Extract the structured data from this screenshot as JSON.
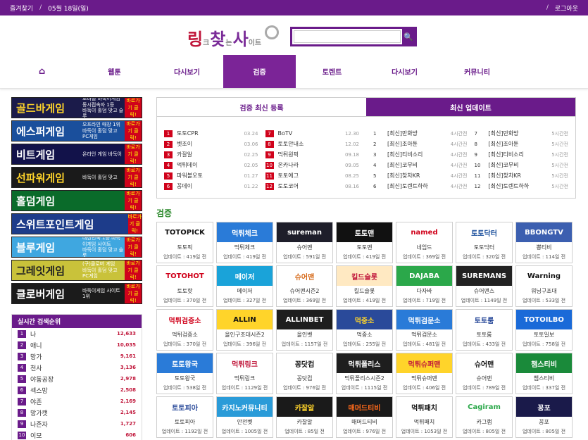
{
  "topbar": {
    "bookmark": "즐겨찾기",
    "date": "05월 18일(일)",
    "logout": "로그아웃"
  },
  "logo": {
    "p1": "링",
    "p2": "크",
    "p3": "찾",
    "p4": "는",
    "p5": "사",
    "p6": "이트"
  },
  "search": {
    "placeholder": "",
    "value": "",
    "icon": "search-icon"
  },
  "nav": [
    {
      "label": "",
      "icon": "home-icon"
    },
    {
      "label": "웹툰"
    },
    {
      "label": "다시보기"
    },
    {
      "label": "검증",
      "active": true
    },
    {
      "label": "토렌트"
    },
    {
      "label": "다시보기"
    },
    {
      "label": "커뮤니티"
    }
  ],
  "banners": [
    {
      "title": "골드바게임",
      "desc": "모바일 바둑이게임 동시접속자 1등",
      "sub": "바둑이 홀덤 맞고 슬롯",
      "cta": "바로가기 클릭!",
      "bg": "#1b1b4a",
      "fg": "#ffd42a"
    },
    {
      "title": "에스퍼게임",
      "desc": "오프라인 매장 1위",
      "sub": "바둑이 홀덤 맞고 PC게임",
      "cta": "바로가기 클릭!",
      "bg": "#1a4f9c",
      "fg": "#ffffff"
    },
    {
      "title": "비트게임",
      "desc": "온라인 게임 바둑이",
      "sub": "",
      "cta": "바로가기 클릭!",
      "bg": "#12124a",
      "fg": "#ffffff"
    },
    {
      "title": "선파워게임",
      "desc": "바둑이 홀덤 맞고",
      "sub": "",
      "cta": "바로가기 클릭!",
      "bg": "#1a1a1a",
      "fg": "#ffd42a"
    },
    {
      "title": "홀덤게임",
      "desc": "",
      "sub": "",
      "cta": "바로가기 클릭!",
      "bg": "#0a6b2a",
      "fg": "#ffffff"
    },
    {
      "title": "스위트포인트게임",
      "desc": "",
      "sub": "",
      "cta": "바로가기 클릭!",
      "bg": "#1d3c8a",
      "fg": "#ffffff"
    },
    {
      "title": "블루게임",
      "desc": "대한민국 1등 바둑이게임 사이트",
      "sub": "바둑이 홀덤 맞고 슬롯",
      "cta": "바로가기 클릭!",
      "bg": "#3fa7e0",
      "fg": "#ffffff"
    },
    {
      "title": "그레잇게임",
      "desc": "(구)클로버 게임",
      "sub": "바둑이 홀덤 맞고 PC게임",
      "cta": "바로가기 클릭!",
      "bg": "#c9c23a",
      "fg": "#222222"
    },
    {
      "title": "클로버게임",
      "desc": "바둑이게임 사이트 1위",
      "sub": "",
      "cta": "바로가기 클릭!",
      "bg": "#1b1b1b",
      "fg": "#ffffff"
    }
  ],
  "rank": {
    "title": "실시간 검색순위",
    "items": [
      {
        "n": "1",
        "t": "나",
        "c": "12,633"
      },
      {
        "n": "2",
        "t": "애니",
        "c": "10,035"
      },
      {
        "n": "3",
        "t": "망가",
        "c": "9,161"
      },
      {
        "n": "4",
        "t": "천사",
        "c": "3,136"
      },
      {
        "n": "5",
        "t": "야동공장",
        "c": "2,978"
      },
      {
        "n": "6",
        "t": "섹스망",
        "c": "2,508"
      },
      {
        "n": "7",
        "t": "야존",
        "c": "2,169"
      },
      {
        "n": "8",
        "t": "망가캣",
        "c": "2,145"
      },
      {
        "n": "9",
        "t": "나존자",
        "c": "1,727"
      },
      {
        "n": "10",
        "t": "이모",
        "c": "606"
      }
    ]
  },
  "recent": {
    "title": "검증 최신 등록",
    "col1": [
      {
        "n": "1",
        "t": "토토CPR",
        "d": "03.24"
      },
      {
        "n": "2",
        "t": "벳조이",
        "d": "03.06"
      },
      {
        "n": "3",
        "t": "카잘알",
        "d": "02.25"
      },
      {
        "n": "4",
        "t": "먹튀데이",
        "d": "02.05"
      },
      {
        "n": "5",
        "t": "파워볼오토",
        "d": "01.27"
      },
      {
        "n": "6",
        "t": "꽁데이",
        "d": "01.22"
      }
    ],
    "col2": [
      {
        "n": "7",
        "t": "BoTV",
        "d": "12.30"
      },
      {
        "n": "8",
        "t": "토토안내소",
        "d": "12.02"
      },
      {
        "n": "9",
        "t": "먹튀원픽",
        "d": "09.18"
      },
      {
        "n": "10",
        "t": "온카나라",
        "d": "09.05"
      },
      {
        "n": "11",
        "t": "토토에그",
        "d": "08.25"
      },
      {
        "n": "12",
        "t": "토토코어",
        "d": "08.16"
      }
    ]
  },
  "updates": {
    "title": "최신 업데이트",
    "col1": [
      {
        "n": "1",
        "t": "[최신]만화방",
        "d": "4시간전"
      },
      {
        "n": "2",
        "t": "[최신]조아툰",
        "d": "4시간전"
      },
      {
        "n": "3",
        "t": "[최신]티비소리",
        "d": "4시간전"
      },
      {
        "n": "4",
        "t": "[최신]코무비",
        "d": "4시간전"
      },
      {
        "n": "5",
        "t": "[최신]찾차KR",
        "d": "4시간전"
      },
      {
        "n": "6",
        "t": "[최신]토렌트하하",
        "d": "4시간전"
      }
    ],
    "col2": [
      {
        "n": "7",
        "t": "[최신]만화방",
        "d": "5시간전"
      },
      {
        "n": "8",
        "t": "[최신]조아툰",
        "d": "5시간전"
      },
      {
        "n": "9",
        "t": "[최신]티비소리",
        "d": "5시간전"
      },
      {
        "n": "10",
        "t": "[최신]코무비",
        "d": "5시간전"
      },
      {
        "n": "11",
        "t": "[최신]찾차KR",
        "d": "5시간전"
      },
      {
        "n": "12",
        "t": "[최신]토렌트하하",
        "d": "5시간전"
      }
    ]
  },
  "section_title": "검증",
  "cards": [
    {
      "logo": "TOTOPICK",
      "name": "토토픽",
      "up": "업데이트 : 419일 전",
      "bg": "#ffffff",
      "fg": "#111111"
    },
    {
      "logo": "먹튀체크",
      "name": "먹튀체크",
      "up": "업데이트 : 419일 전",
      "bg": "#2a7bd8",
      "fg": "#ffffff"
    },
    {
      "logo": "sureman",
      "name": "슈어맨",
      "up": "업데이트 : 591일 전",
      "bg": "#1e1e2a",
      "fg": "#ffffff"
    },
    {
      "logo": "토토맨",
      "name": "토토맨",
      "up": "업데이트 : 419일 전",
      "bg": "#111111",
      "fg": "#ffffff"
    },
    {
      "logo": "named",
      "name": "네임드",
      "up": "업데이트 : 369일 전",
      "bg": "#ffffff",
      "fg": "#d0021b"
    },
    {
      "logo": "토토닥터",
      "name": "토토닥터",
      "up": "업데이트 : 320일 전",
      "bg": "#ffffff",
      "fg": "#1a4f9c"
    },
    {
      "logo": "BBONGTV",
      "name": "뽕티비",
      "up": "업데이트 : 114일 전",
      "bg": "#3c5fb0",
      "fg": "#ffffff"
    },
    {
      "logo": "TOTOHOT",
      "name": "토토핫",
      "up": "업데이트 : 370일 전",
      "bg": "#ffffff",
      "fg": "#d0021b"
    },
    {
      "logo": "메이저",
      "name": "메이저",
      "up": "업데이트 : 327일 전",
      "bg": "#1aa3d9",
      "fg": "#ffffff"
    },
    {
      "logo": "슈어맨",
      "name": "슈어맨시즌2",
      "up": "업데이트 : 369일 전",
      "bg": "#ffffff",
      "fg": "#d66a1a"
    },
    {
      "logo": "킬드슬롯",
      "name": "킬드슬롯",
      "up": "업데이트 : 419일 전",
      "bg": "#ffe9c2",
      "fg": "#c0163a"
    },
    {
      "logo": "DAJABA",
      "name": "다자바",
      "up": "업데이트 : 719일 전",
      "bg": "#2ba84a",
      "fg": "#ffffff"
    },
    {
      "logo": "SUREMANS",
      "name": "슈어맨스",
      "up": "업데이트 : 1149일 전",
      "bg": "#222222",
      "fg": "#ffffff"
    },
    {
      "logo": "Warning",
      "name": "워닝구조대",
      "up": "업데이트 : 533일 전",
      "bg": "#ffffff",
      "fg": "#111111"
    },
    {
      "logo": "먹튀검증소",
      "name": "먹튀검증소",
      "up": "업데이트 : 370일 전",
      "bg": "#ffffff",
      "fg": "#d0021b"
    },
    {
      "logo": "ALLIN",
      "name": "올인구조대시즌2",
      "up": "업데이트 : 396일 전",
      "bg": "#ffd42a",
      "fg": "#111111"
    },
    {
      "logo": "ALLINBET",
      "name": "올인벳",
      "up": "업데이트 : 1157일 전",
      "bg": "#1e1e1e",
      "fg": "#ffffff"
    },
    {
      "logo": "먹중소",
      "name": "먹중소",
      "up": "업데이트 : 255일 전",
      "bg": "#2a4a9a",
      "fg": "#ffd42a"
    },
    {
      "logo": "먹튀검문소",
      "name": "먹튀검문소",
      "up": "업데이트 : 481일 전",
      "bg": "#2a7bd8",
      "fg": "#ffffff"
    },
    {
      "logo": "토토룸",
      "name": "토토룸",
      "up": "업데이트 : 433일 전",
      "bg": "#ffffff",
      "fg": "#2a4a9a"
    },
    {
      "logo": "TOTOILBO",
      "name": "토토일보",
      "up": "업데이트 : 758일 전",
      "bg": "#1a6ad8",
      "fg": "#ffffff"
    },
    {
      "logo": "토토왕국",
      "name": "토토왕국",
      "up": "업데이트 : 538일 전",
      "bg": "#2a7bd8",
      "fg": "#ffffff"
    },
    {
      "logo": "먹튀링크",
      "name": "먹튀링크",
      "up": "업데이트 : 1129일 전",
      "bg": "#ffffff",
      "fg": "#c0163a"
    },
    {
      "logo": "꽁닷컴",
      "name": "꽁닷컴",
      "up": "업데이트 : 976일 전",
      "bg": "#ffffff",
      "fg": "#111111"
    },
    {
      "logo": "먹튀폴리스",
      "name": "먹튀폴리스시즌2",
      "up": "업데이트 : 1115일 전",
      "bg": "#1e1e1e",
      "fg": "#ffffff"
    },
    {
      "logo": "먹튀슈퍼맨",
      "name": "먹튀슈퍼맨",
      "up": "업데이트 : 406일 전",
      "bg": "#ffd42a",
      "fg": "#c0163a"
    },
    {
      "logo": "슈어맨",
      "name": "슈어맨",
      "up": "업데이트 : 789일 전",
      "bg": "#ffffff",
      "fg": "#111111"
    },
    {
      "logo": "챔스티비",
      "name": "챔스티비",
      "up": "업데이트 : 337일 전",
      "bg": "#1a8a3a",
      "fg": "#ffffff"
    },
    {
      "logo": "토토피아",
      "name": "토토피아",
      "up": "업데이트 : 1192일 전",
      "bg": "#ffffff",
      "fg": "#2a4a9a"
    },
    {
      "logo": "카지노커뮤니티",
      "name": "안전벳",
      "up": "업데이트 : 1005일 전",
      "bg": "#2a9bd8",
      "fg": "#ffffff"
    },
    {
      "logo": "카잘알",
      "name": "카잘알",
      "up": "업데이트 : 85일 전",
      "bg": "#1a1a1a",
      "fg": "#ffd42a"
    },
    {
      "logo": "매머드티비",
      "name": "매머드티비",
      "up": "업데이트 : 976일 전",
      "bg": "#1a1a1a",
      "fg": "#ff6a1a"
    },
    {
      "logo": "먹튀패치",
      "name": "먹튀패치",
      "up": "업데이트 : 1053일 전",
      "bg": "#ffffff",
      "fg": "#111111"
    },
    {
      "logo": "Cagiram",
      "name": "카그램",
      "up": "업데이트 : 805일 전",
      "bg": "#ffffff",
      "fg": "#2ba84a"
    },
    {
      "logo": "꽁포",
      "name": "꽁포",
      "up": "업데이트 : 805일 전",
      "bg": "#1a1a4a",
      "fg": "#ffffff"
    }
  ]
}
